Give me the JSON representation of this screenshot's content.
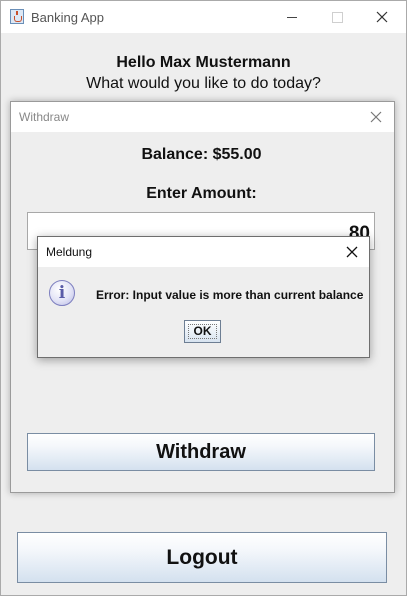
{
  "main_window": {
    "title": "Banking App",
    "icon": "java-cup-icon",
    "greeting": "Hello Max Mustermann",
    "prompt": "What would you like to do today?",
    "logout_label": "Logout"
  },
  "withdraw_dialog": {
    "title": "Withdraw",
    "balance_text": "Balance: $55.00",
    "amount_label": "Enter Amount:",
    "amount_value": "80",
    "withdraw_label": "Withdraw"
  },
  "message_dialog": {
    "title": "Meldung",
    "icon": "info-icon",
    "message": "Error: Input value is more than current balance",
    "ok_label": "OK"
  },
  "colors": {
    "window_background": "#eeeeee",
    "titlebar": "#ffffff",
    "button_gradient_bottom": "#d4e1ef",
    "button_border": "#7a8da3"
  }
}
